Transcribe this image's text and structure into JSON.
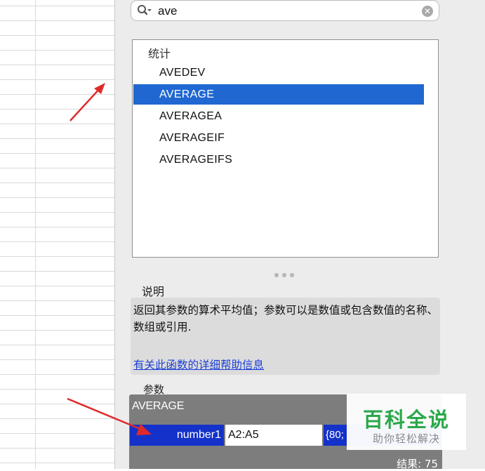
{
  "search": {
    "value": "ave",
    "icon": "search-icon",
    "clear_icon": "clear-icon"
  },
  "function_list": {
    "category": "统计",
    "items": [
      {
        "label": "AVEDEV",
        "selected": false
      },
      {
        "label": "AVERAGE",
        "selected": true
      },
      {
        "label": "AVERAGEA",
        "selected": false
      },
      {
        "label": "AVERAGEIF",
        "selected": false
      },
      {
        "label": "AVERAGEIFS",
        "selected": false
      }
    ]
  },
  "description": {
    "label": "说明",
    "text": "返回其参数的算术平均值；参数可以是数值或包含数值的名称、数组或引用.",
    "help_link": "有关此函数的详细帮助信息"
  },
  "arguments": {
    "label": "参数",
    "function_name": "AVERAGE",
    "rows": [
      {
        "name": "number1",
        "value": "A2:A5",
        "evaluated": "{80;"
      }
    ],
    "result": "结果: 75"
  },
  "watermark": {
    "title": "百科全说",
    "subtitle": "助你轻松解决"
  },
  "colors": {
    "selection": "#2067d2",
    "argument_highlight": "#1432c9",
    "link": "#1a3fd6",
    "annotation_arrow": "#e02a2a",
    "watermark_green": "#2aa84a"
  }
}
